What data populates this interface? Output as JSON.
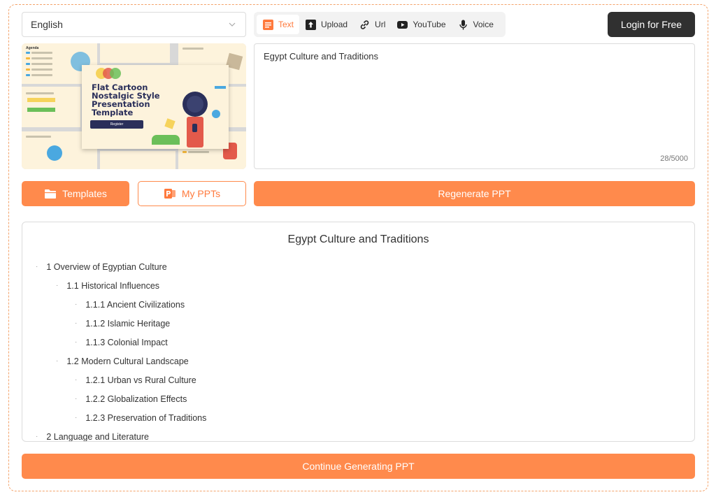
{
  "language": {
    "selected": "English"
  },
  "input_tabs": [
    {
      "label": "Text",
      "icon": "document-icon",
      "active": true
    },
    {
      "label": "Upload",
      "icon": "upload-icon",
      "active": false
    },
    {
      "label": "Url",
      "icon": "link-icon",
      "active": false
    },
    {
      "label": "YouTube",
      "icon": "youtube-icon",
      "active": false
    },
    {
      "label": "Voice",
      "icon": "microphone-icon",
      "active": false
    }
  ],
  "header": {
    "login_label": "Login for Free"
  },
  "template_preview": {
    "title": "Flat Cartoon Nostalgic Style Presentation Template",
    "register_label": "Register",
    "agenda_label": "Agenda"
  },
  "topic": {
    "value": "Egypt Culture and Traditions",
    "counter": "28/5000"
  },
  "actions": {
    "templates_label": "Templates",
    "my_ppts_label": "My PPTs",
    "regenerate_label": "Regenerate PPT",
    "continue_label": "Continue Generating PPT"
  },
  "outline": {
    "title": "Egypt Culture and Traditions",
    "items": [
      {
        "level": 1,
        "text": "1 Overview of Egyptian Culture"
      },
      {
        "level": 2,
        "text": "1.1 Historical Influences"
      },
      {
        "level": 3,
        "text": "1.1.1 Ancient Civilizations"
      },
      {
        "level": 3,
        "text": "1.1.2 Islamic Heritage"
      },
      {
        "level": 3,
        "text": "1.1.3 Colonial Impact"
      },
      {
        "level": 2,
        "text": "1.2 Modern Cultural Landscape"
      },
      {
        "level": 3,
        "text": "1.2.1 Urban vs Rural Culture"
      },
      {
        "level": 3,
        "text": "1.2.2 Globalization Effects"
      },
      {
        "level": 3,
        "text": "1.2.3 Preservation of Traditions"
      },
      {
        "level": 1,
        "text": "2 Language and Literature"
      }
    ]
  },
  "colors": {
    "accent": "#ff8a4c",
    "accent_text": "#ff7a3d",
    "dark_button": "#303030",
    "border": "#dcdcdc"
  }
}
